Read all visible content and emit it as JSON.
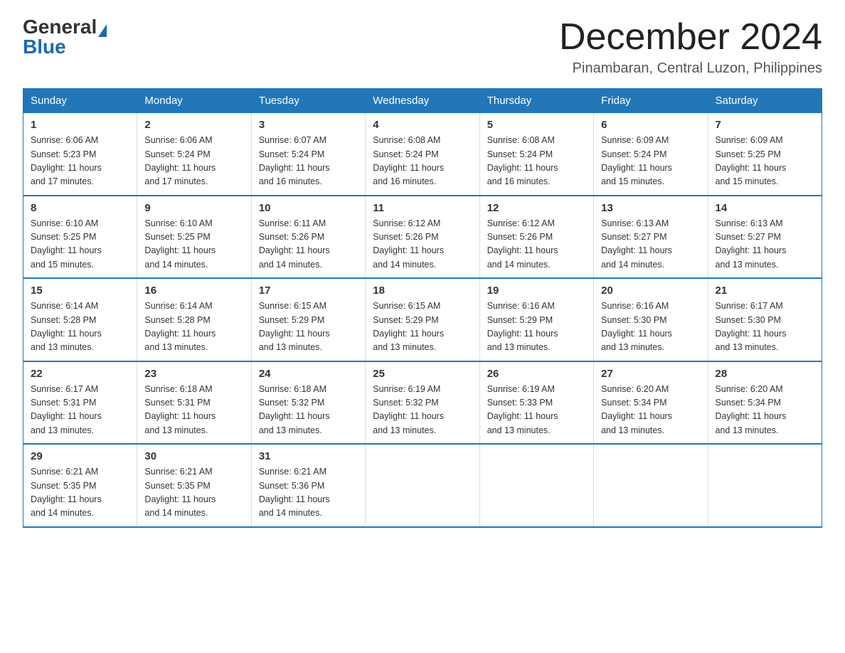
{
  "logo": {
    "general": "General",
    "blue": "Blue"
  },
  "title": "December 2024",
  "location": "Pinambaran, Central Luzon, Philippines",
  "headers": [
    "Sunday",
    "Monday",
    "Tuesday",
    "Wednesday",
    "Thursday",
    "Friday",
    "Saturday"
  ],
  "weeks": [
    [
      {
        "day": "1",
        "sunrise": "6:06 AM",
        "sunset": "5:23 PM",
        "daylight": "11 hours and 17 minutes."
      },
      {
        "day": "2",
        "sunrise": "6:06 AM",
        "sunset": "5:24 PM",
        "daylight": "11 hours and 17 minutes."
      },
      {
        "day": "3",
        "sunrise": "6:07 AM",
        "sunset": "5:24 PM",
        "daylight": "11 hours and 16 minutes."
      },
      {
        "day": "4",
        "sunrise": "6:08 AM",
        "sunset": "5:24 PM",
        "daylight": "11 hours and 16 minutes."
      },
      {
        "day": "5",
        "sunrise": "6:08 AM",
        "sunset": "5:24 PM",
        "daylight": "11 hours and 16 minutes."
      },
      {
        "day": "6",
        "sunrise": "6:09 AM",
        "sunset": "5:24 PM",
        "daylight": "11 hours and 15 minutes."
      },
      {
        "day": "7",
        "sunrise": "6:09 AM",
        "sunset": "5:25 PM",
        "daylight": "11 hours and 15 minutes."
      }
    ],
    [
      {
        "day": "8",
        "sunrise": "6:10 AM",
        "sunset": "5:25 PM",
        "daylight": "11 hours and 15 minutes."
      },
      {
        "day": "9",
        "sunrise": "6:10 AM",
        "sunset": "5:25 PM",
        "daylight": "11 hours and 14 minutes."
      },
      {
        "day": "10",
        "sunrise": "6:11 AM",
        "sunset": "5:26 PM",
        "daylight": "11 hours and 14 minutes."
      },
      {
        "day": "11",
        "sunrise": "6:12 AM",
        "sunset": "5:26 PM",
        "daylight": "11 hours and 14 minutes."
      },
      {
        "day": "12",
        "sunrise": "6:12 AM",
        "sunset": "5:26 PM",
        "daylight": "11 hours and 14 minutes."
      },
      {
        "day": "13",
        "sunrise": "6:13 AM",
        "sunset": "5:27 PM",
        "daylight": "11 hours and 14 minutes."
      },
      {
        "day": "14",
        "sunrise": "6:13 AM",
        "sunset": "5:27 PM",
        "daylight": "11 hours and 13 minutes."
      }
    ],
    [
      {
        "day": "15",
        "sunrise": "6:14 AM",
        "sunset": "5:28 PM",
        "daylight": "11 hours and 13 minutes."
      },
      {
        "day": "16",
        "sunrise": "6:14 AM",
        "sunset": "5:28 PM",
        "daylight": "11 hours and 13 minutes."
      },
      {
        "day": "17",
        "sunrise": "6:15 AM",
        "sunset": "5:29 PM",
        "daylight": "11 hours and 13 minutes."
      },
      {
        "day": "18",
        "sunrise": "6:15 AM",
        "sunset": "5:29 PM",
        "daylight": "11 hours and 13 minutes."
      },
      {
        "day": "19",
        "sunrise": "6:16 AM",
        "sunset": "5:29 PM",
        "daylight": "11 hours and 13 minutes."
      },
      {
        "day": "20",
        "sunrise": "6:16 AM",
        "sunset": "5:30 PM",
        "daylight": "11 hours and 13 minutes."
      },
      {
        "day": "21",
        "sunrise": "6:17 AM",
        "sunset": "5:30 PM",
        "daylight": "11 hours and 13 minutes."
      }
    ],
    [
      {
        "day": "22",
        "sunrise": "6:17 AM",
        "sunset": "5:31 PM",
        "daylight": "11 hours and 13 minutes."
      },
      {
        "day": "23",
        "sunrise": "6:18 AM",
        "sunset": "5:31 PM",
        "daylight": "11 hours and 13 minutes."
      },
      {
        "day": "24",
        "sunrise": "6:18 AM",
        "sunset": "5:32 PM",
        "daylight": "11 hours and 13 minutes."
      },
      {
        "day": "25",
        "sunrise": "6:19 AM",
        "sunset": "5:32 PM",
        "daylight": "11 hours and 13 minutes."
      },
      {
        "day": "26",
        "sunrise": "6:19 AM",
        "sunset": "5:33 PM",
        "daylight": "11 hours and 13 minutes."
      },
      {
        "day": "27",
        "sunrise": "6:20 AM",
        "sunset": "5:34 PM",
        "daylight": "11 hours and 13 minutes."
      },
      {
        "day": "28",
        "sunrise": "6:20 AM",
        "sunset": "5:34 PM",
        "daylight": "11 hours and 13 minutes."
      }
    ],
    [
      {
        "day": "29",
        "sunrise": "6:21 AM",
        "sunset": "5:35 PM",
        "daylight": "11 hours and 14 minutes."
      },
      {
        "day": "30",
        "sunrise": "6:21 AM",
        "sunset": "5:35 PM",
        "daylight": "11 hours and 14 minutes."
      },
      {
        "day": "31",
        "sunrise": "6:21 AM",
        "sunset": "5:36 PM",
        "daylight": "11 hours and 14 minutes."
      },
      null,
      null,
      null,
      null
    ]
  ],
  "labels": {
    "sunrise": "Sunrise:",
    "sunset": "Sunset:",
    "daylight": "Daylight:"
  }
}
